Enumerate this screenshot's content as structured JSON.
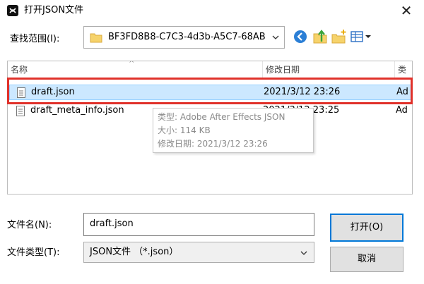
{
  "window": {
    "title": "打开JSON文件",
    "close_glyph": "✕"
  },
  "lookin": {
    "label": "查找范围(I):",
    "value": "BF3FD8B8-C7C3-4d3b-A5C7-68AB"
  },
  "list": {
    "columns": {
      "name": "名称",
      "date": "修改日期",
      "type": "类"
    },
    "sort_glyph": "^",
    "files": [
      {
        "name": "draft.json",
        "date": "2021/3/12 23:26",
        "type": "Ad"
      },
      {
        "name": "draft_meta_info.json",
        "date": "2021/3/12 23:25",
        "type": "Ad"
      }
    ]
  },
  "tooltip": {
    "type_line": "类型: Adobe After Effects JSON",
    "size_line": "大小: 114 KB",
    "date_line": "修改日期: 2021/3/12 23:26"
  },
  "filename": {
    "label": "文件名(N):",
    "value": "draft.json"
  },
  "filetype": {
    "label": "文件类型(T):",
    "value": "JSON文件 （*.json）"
  },
  "buttons": {
    "open": "打开(O)",
    "cancel": "取消"
  },
  "colors": {
    "selection": "#cce8ff",
    "highlight_box": "#e0312a",
    "default_button_border": "#0078d7"
  },
  "icons": [
    "app-icon",
    "folder-icon",
    "back-icon",
    "up-folder-icon",
    "new-folder-icon",
    "view-menu-icon",
    "file-icon",
    "chevron-down-icon",
    "close-icon"
  ]
}
